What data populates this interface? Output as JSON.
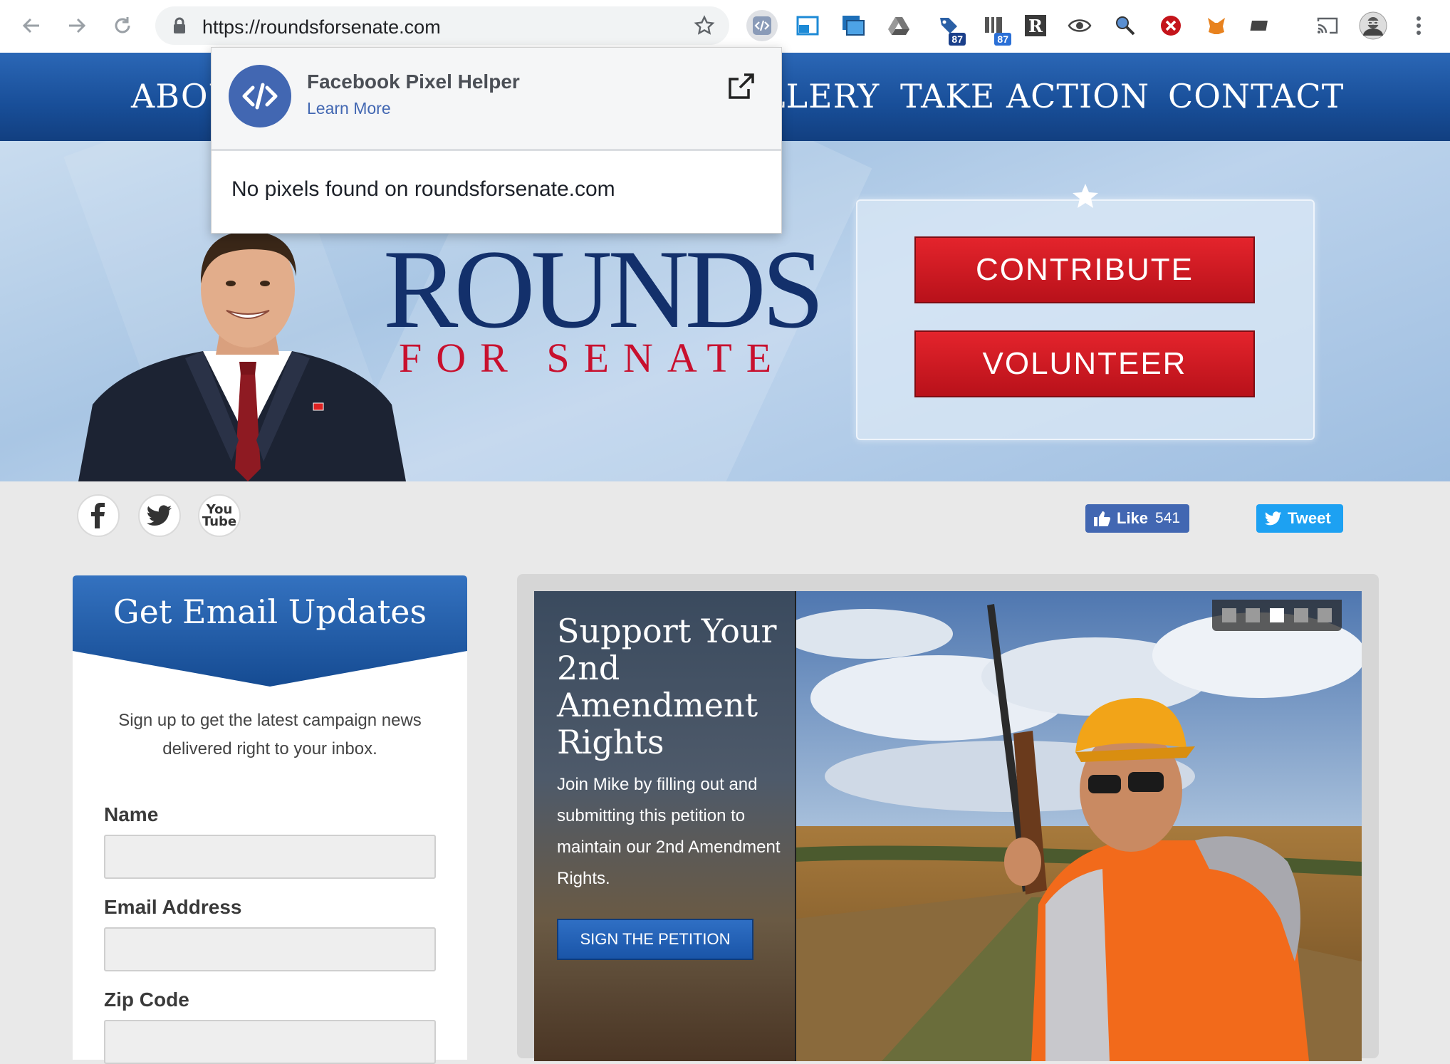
{
  "browser": {
    "url": "https://roundsforsenate.com",
    "extensions": [
      {
        "name": "facebook-pixel-helper",
        "active": true
      },
      {
        "name": "window-extension"
      },
      {
        "name": "screenshot-extension"
      },
      {
        "name": "drive-extension"
      },
      {
        "name": "tag-extension",
        "badge": "87"
      },
      {
        "name": "tracker-extension",
        "badge": "87"
      },
      {
        "name": "readability-extension",
        "glyph": "R"
      },
      {
        "name": "eye-extension"
      },
      {
        "name": "magnifier-extension"
      },
      {
        "name": "blocker-extension"
      },
      {
        "name": "metamask-extension"
      },
      {
        "name": "screen-extension"
      }
    ]
  },
  "site_nav": {
    "items": [
      "ABOUT",
      "GALLERY",
      "TAKE ACTION",
      "CONTACT"
    ]
  },
  "hero": {
    "logo_main": "ROUNDS",
    "logo_sub": "FOR SENATE",
    "buttons": {
      "contribute": "CONTRIBUTE",
      "volunteer": "VOLUNTEER"
    }
  },
  "social": {
    "icons": [
      "facebook-icon",
      "twitter-icon",
      "youtube-icon"
    ],
    "youtube_text": [
      "You",
      "Tube"
    ],
    "like_label": "Like",
    "like_count": "541",
    "tweet_label": "Tweet"
  },
  "email": {
    "title": "Get Email Updates",
    "description": "Sign up to get the latest campaign news delivered right to your inbox.",
    "fields": {
      "name": "Name",
      "email": "Email Address",
      "zip": "Zip Code"
    }
  },
  "slider": {
    "title": "Support Your 2nd Amendment Rights",
    "body": "Join Mike by filling out and submitting this petition to maintain our 2nd Amendment Rights.",
    "button": "SIGN THE PETITION",
    "dots": 5,
    "active_dot": 3
  },
  "popup": {
    "title": "Facebook Pixel Helper",
    "learn_more": "Learn More",
    "message": "No pixels found on roundsforsenate.com"
  },
  "colors": {
    "nav_blue": "#184e98",
    "brand_navy": "#13306b",
    "brand_red": "#c8102e",
    "fb_blue": "#4267b2",
    "twitter_blue": "#1da1f2"
  }
}
